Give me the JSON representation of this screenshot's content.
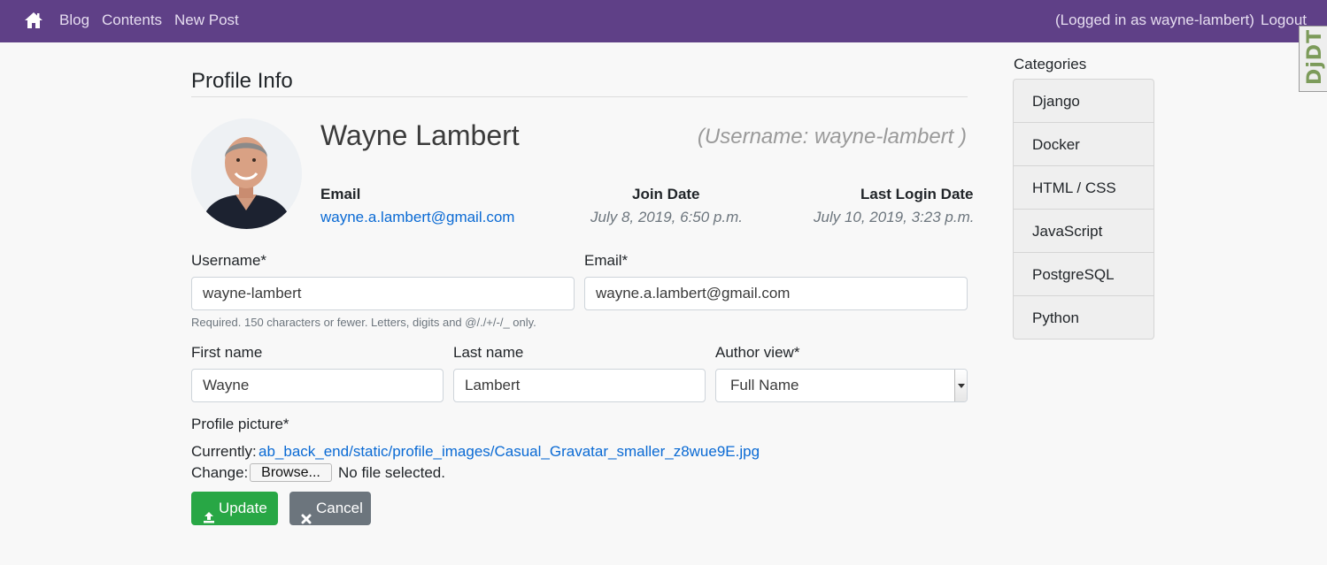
{
  "navbar": {
    "home_icon": "home-icon",
    "links": [
      "Blog",
      "Contents",
      "New Post"
    ],
    "logged_in_text": "(Logged in as wayne-lambert)",
    "logout_label": "Logout",
    "background_color": "#5f4087"
  },
  "debug_toolbar": {
    "label": "DjDT"
  },
  "profile": {
    "section_title": "Profile Info",
    "full_name": "Wayne Lambert",
    "username_note": "(Username: wayne-lambert )",
    "email_label": "Email",
    "email_value": "wayne.a.lambert@gmail.com",
    "join_label": "Join Date",
    "join_value": "July 8, 2019, 6:50 p.m.",
    "last_login_label": "Last Login Date",
    "last_login_value": "July 10, 2019, 3:23 p.m."
  },
  "form": {
    "username_label": "Username*",
    "username_value": "wayne-lambert",
    "username_help": "Required. 150 characters or fewer. Letters, digits and @/./+/-/_ only.",
    "email_label": "Email*",
    "email_value": "wayne.a.lambert@gmail.com",
    "first_name_label": "First name",
    "first_name_value": "Wayne",
    "last_name_label": "Last name",
    "last_name_value": "Lambert",
    "author_view_label": "Author view*",
    "author_view_value": "Full Name",
    "picture_label": "Profile picture*",
    "currently_label": "Currently:",
    "currently_path": "ab_back_end/static/profile_images/Casual_Gravatar_smaller_z8wue9E.jpg",
    "change_label": "Change:",
    "browse_label": "Browse...",
    "no_file_text": "No file selected.",
    "update_label": "Update",
    "update_icon": "upload-icon",
    "cancel_label": "Cancel",
    "cancel_icon": "close-icon",
    "update_color": "#28a745",
    "cancel_color": "#6c757d"
  },
  "sidebar": {
    "title": "Categories",
    "items": [
      "Django",
      "Docker",
      "HTML / CSS",
      "JavaScript",
      "PostgreSQL",
      "Python"
    ]
  }
}
